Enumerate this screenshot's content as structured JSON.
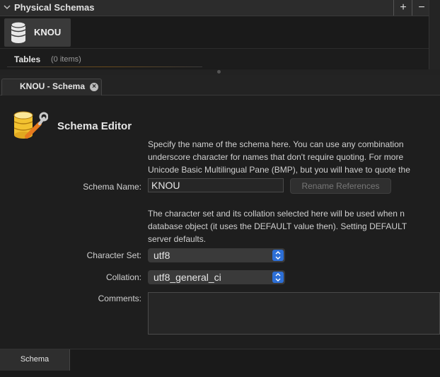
{
  "physical_schemas": {
    "title": "Physical Schemas",
    "add_label": "+",
    "remove_label": "−",
    "schema_name": "KNOU",
    "tables_label": "Tables",
    "tables_count": "(0 items)"
  },
  "tab": {
    "label": "KNOU - Schema",
    "close": "×"
  },
  "editor": {
    "title": "Schema Editor",
    "description_lines": [
      "Specify the name of the schema here. You can use any combination",
      "underscore character for names that don't require quoting. For more",
      "Unicode Basic Multilingual Pane (BMP), but you will have to quote the"
    ],
    "charset_description_lines": [
      "The character set and its collation selected here will be used when n",
      "database object (it uses the DEFAULT value then). Setting DEFAULT",
      "server defaults."
    ],
    "schema_name_label": "Schema Name:",
    "schema_name_value": "KNOU",
    "rename_button": "Rename References",
    "charset_label": "Character Set:",
    "charset_value": "utf8",
    "collation_label": "Collation:",
    "collation_value": "utf8_general_ci",
    "comments_label": "Comments:",
    "comments_value": ""
  },
  "bottom_tabs": [
    {
      "label": "Schema"
    }
  ],
  "colors": {
    "accent": "#2d6fd6",
    "background": "#1e1e1e"
  }
}
